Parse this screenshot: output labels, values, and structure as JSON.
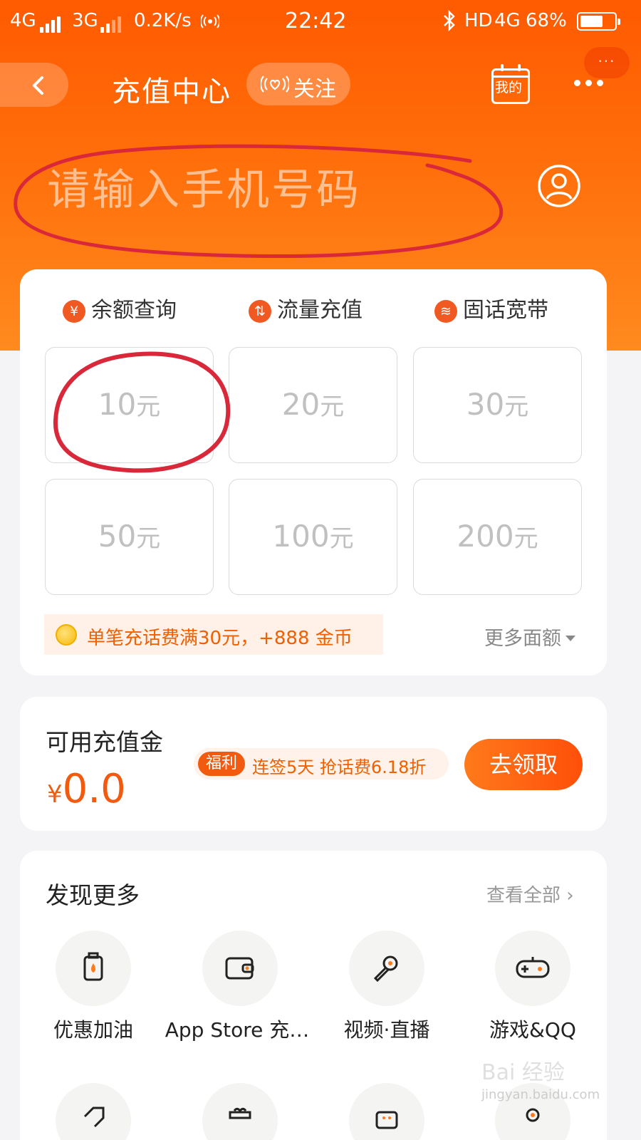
{
  "status_bar": {
    "network1": "4G",
    "network2": "3G",
    "speed": "0.2K/s",
    "time": "22:42",
    "hd_label": "HD",
    "network3": "4G",
    "battery_percent": "68%",
    "battery_level": 0.68
  },
  "nav": {
    "title": "充值中心",
    "follow_label": "关注",
    "mine_label": "我的",
    "mini_more": "···"
  },
  "phone_input": {
    "placeholder": "请输入手机号码"
  },
  "quick_actions": [
    {
      "label": "余额查询",
      "icon": "yen-search-icon",
      "glyph": "¥"
    },
    {
      "label": "流量充值",
      "icon": "data-flow-icon",
      "glyph": "⇅"
    },
    {
      "label": "固话宽带",
      "icon": "wifi-icon",
      "glyph": "≋"
    }
  ],
  "amounts": [
    {
      "value": "10",
      "unit": "元"
    },
    {
      "value": "20",
      "unit": "元"
    },
    {
      "value": "30",
      "unit": "元"
    },
    {
      "value": "50",
      "unit": "元"
    },
    {
      "value": "100",
      "unit": "元"
    },
    {
      "value": "200",
      "unit": "元"
    }
  ],
  "promo": {
    "text": "单笔充话费满30元，+888 金币"
  },
  "more_amounts": "更多面额",
  "balance": {
    "title": "可用充值金",
    "currency": "¥",
    "value": "0.0",
    "welfare_tag": "福利",
    "welfare_text": "连签5天 抢话费6.18折",
    "claim_label": "去领取"
  },
  "discover": {
    "title": "发现更多",
    "see_all": "查看全部 ›",
    "items": [
      {
        "label": "优惠加油",
        "icon": "fuel-icon"
      },
      {
        "label": "App Store 充…",
        "icon": "wallet-icon"
      },
      {
        "label": "视频·直播",
        "icon": "microphone-icon"
      },
      {
        "label": "游戏&QQ",
        "icon": "gamepad-icon"
      }
    ]
  },
  "watermark": {
    "main": "Bai 经验",
    "sub": "jingyan.baidu.com"
  },
  "colors": {
    "brand_orange": "#ff5a00",
    "accent_red": "#f25a10",
    "annotation_red": "#d8283a"
  }
}
